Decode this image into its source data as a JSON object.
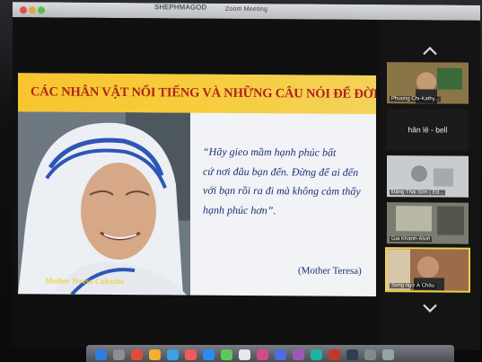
{
  "window": {
    "title": "Zoom Meeting",
    "speaker_fragment": "SHEPHMAGOD"
  },
  "slide": {
    "title": "CÁC NHÂN VẬT NỔI TIẾNG VÀ NHỮNG CÂU NÓI ĐỂ ĐỜI",
    "photo_caption": "Mother Teresa Calcutta",
    "quote_lines": [
      "“Hãy gieo mầm hạnh phúc bất",
      "cứ nơi đâu bạn đến. Đừng để ai đến",
      "với bạn rồi ra đi mà không cảm thấy",
      "hạnh phúc hơn”."
    ],
    "author": "(Mother Teresa)"
  },
  "gallery": {
    "participants": [
      {
        "name": "Phuong Chi-Kathy...",
        "type": "video"
      },
      {
        "name": "hân lê - bell",
        "type": "text"
      },
      {
        "name": "Đặng Thái Sơn ( Ed...",
        "type": "video"
      },
      {
        "name": "Gia Khánh-Alvin",
        "type": "video"
      },
      {
        "name": "Song ngữ Á Châu",
        "type": "video",
        "active": true
      }
    ]
  },
  "colors": {
    "banner": "#f7c52e",
    "title_red": "#b2221a",
    "quote_blue": "#1f2f72",
    "active_speaker": "#f4d14a"
  },
  "icons": [
    "scroll-up-icon",
    "scroll-down-icon"
  ]
}
